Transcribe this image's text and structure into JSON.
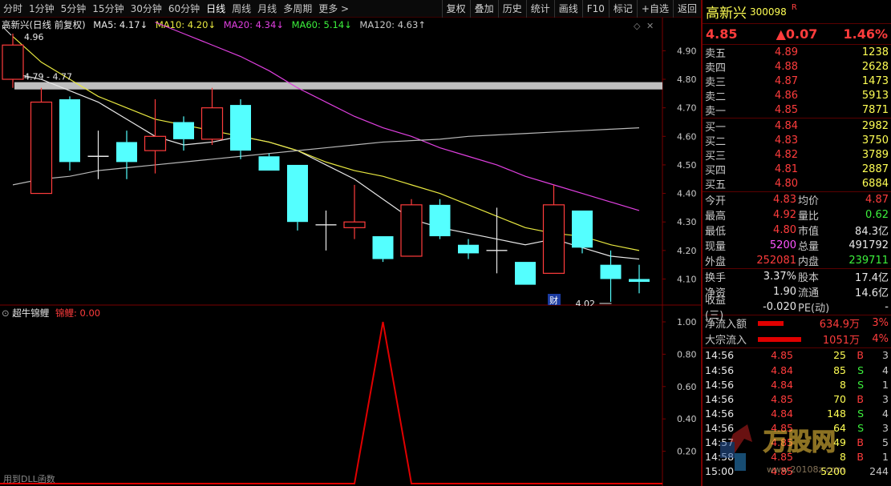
{
  "toolbar": {
    "periods": [
      "分时",
      "1分钟",
      "5分钟",
      "15分钟",
      "30分钟",
      "60分钟",
      "日线",
      "周线",
      "月线",
      "多周期",
      "更多 >"
    ],
    "active_period": "日线",
    "buttons": [
      "复权",
      "叠加",
      "历史",
      "统计",
      "画线",
      "F10",
      "标记",
      "+自选",
      "返回"
    ]
  },
  "main_legend": {
    "title": "高新兴(日线 前复权)",
    "ma5": "MA5: 4.17↓",
    "ma10": "MA10: 4.20↓",
    "ma20": "MA20: 4.34↓",
    "ma60": "MA60: 5.14↓",
    "ma120": "MA120: 4.63↑"
  },
  "sub_legend": {
    "name": "超牛锦鲤",
    "series": "锦鲤: 0.00"
  },
  "footnote": "用到DLL函数",
  "chart_data": [
    {
      "type": "candlestick",
      "title": "高新兴(日线 前复权)",
      "ylim": [
        4.02,
        4.96
      ],
      "yticks": [
        "4.90",
        "4.80",
        "4.70",
        "4.60",
        "4.50",
        "4.40",
        "4.30",
        "4.20",
        "4.10"
      ],
      "annotations": {
        "high": "4.96",
        "low": "4.02",
        "range_line": "4.79 - 4.77",
        "marker": "财"
      },
      "candles": [
        {
          "o": 4.8,
          "h": 4.96,
          "l": 4.77,
          "c": 4.92
        },
        {
          "o": 4.4,
          "h": 4.77,
          "l": 4.4,
          "c": 4.72
        },
        {
          "o": 4.73,
          "h": 4.74,
          "l": 4.48,
          "c": 4.51
        },
        {
          "o": 4.53,
          "h": 4.62,
          "l": 4.45,
          "c": 4.53
        },
        {
          "o": 4.58,
          "h": 4.62,
          "l": 4.45,
          "c": 4.51
        },
        {
          "o": 4.55,
          "h": 4.73,
          "l": 4.47,
          "c": 4.6
        },
        {
          "o": 4.65,
          "h": 4.67,
          "l": 4.55,
          "c": 4.59
        },
        {
          "o": 4.59,
          "h": 4.77,
          "l": 4.57,
          "c": 4.7
        },
        {
          "o": 4.71,
          "h": 4.73,
          "l": 4.52,
          "c": 4.55
        },
        {
          "o": 4.53,
          "h": 4.54,
          "l": 4.48,
          "c": 4.48
        },
        {
          "o": 4.5,
          "h": 4.5,
          "l": 4.27,
          "c": 4.3
        },
        {
          "o": 4.29,
          "h": 4.34,
          "l": 4.2,
          "c": 4.29
        },
        {
          "o": 4.28,
          "h": 4.43,
          "l": 4.24,
          "c": 4.3
        },
        {
          "o": 4.25,
          "h": 4.25,
          "l": 4.16,
          "c": 4.17
        },
        {
          "o": 4.18,
          "h": 4.38,
          "l": 4.18,
          "c": 4.36
        },
        {
          "o": 4.36,
          "h": 4.38,
          "l": 4.24,
          "c": 4.25
        },
        {
          "o": 4.22,
          "h": 4.24,
          "l": 4.17,
          "c": 4.19
        },
        {
          "o": 4.2,
          "h": 4.35,
          "l": 4.12,
          "c": 4.2
        },
        {
          "o": 4.16,
          "h": 4.16,
          "l": 4.08,
          "c": 4.08
        },
        {
          "o": 4.12,
          "h": 4.43,
          "l": 4.12,
          "c": 4.36
        },
        {
          "o": 4.34,
          "h": 4.34,
          "l": 4.19,
          "c": 4.21
        },
        {
          "o": 4.15,
          "h": 4.2,
          "l": 4.02,
          "c": 4.1
        },
        {
          "o": 4.1,
          "h": 4.15,
          "l": 4.05,
          "c": 4.09
        }
      ],
      "series": [
        {
          "name": "MA5",
          "color": "#e8e8e8",
          "values": [
            4.82,
            4.8,
            4.76,
            4.72,
            4.66,
            4.6,
            4.57,
            4.58,
            4.6,
            4.58,
            4.55,
            4.5,
            4.45,
            4.38,
            4.31,
            4.28,
            4.26,
            4.24,
            4.22,
            4.24,
            4.21,
            4.18,
            4.17
          ]
        },
        {
          "name": "MA10",
          "color": "#e8e840",
          "values": [
            4.95,
            4.86,
            4.8,
            4.74,
            4.7,
            4.66,
            4.64,
            4.62,
            4.6,
            4.58,
            4.55,
            4.51,
            4.48,
            4.46,
            4.43,
            4.4,
            4.36,
            4.32,
            4.28,
            4.26,
            4.25,
            4.22,
            4.2
          ]
        },
        {
          "name": "MA20",
          "color": "#e040e0",
          "values": [
            null,
            null,
            null,
            null,
            null,
            5.0,
            4.96,
            4.92,
            4.88,
            4.83,
            4.77,
            4.72,
            4.67,
            4.63,
            4.6,
            4.56,
            4.53,
            4.5,
            4.46,
            4.43,
            4.4,
            4.37,
            4.34
          ]
        },
        {
          "name": "MA120",
          "color": "#b8b8b8",
          "values": [
            4.43,
            4.45,
            4.46,
            4.48,
            4.49,
            4.5,
            4.51,
            4.52,
            4.53,
            4.54,
            4.55,
            4.56,
            4.57,
            4.58,
            4.585,
            4.59,
            4.6,
            4.605,
            4.61,
            4.615,
            4.62,
            4.625,
            4.63
          ]
        }
      ]
    },
    {
      "type": "line",
      "title": "超牛锦鲤",
      "ylim": [
        0,
        1
      ],
      "yticks": [
        "1.00",
        "0.80",
        "0.60",
        "0.40",
        "0.20"
      ],
      "series": [
        {
          "name": "锦鲤",
          "color": "#e00000",
          "values": [
            0,
            0,
            0,
            0,
            0,
            0,
            0,
            0,
            0,
            0,
            0,
            0,
            0,
            1,
            0,
            0,
            0,
            0,
            0,
            0,
            0,
            0,
            0
          ]
        }
      ]
    }
  ],
  "panel": {
    "name": "高新兴",
    "code": "300098",
    "r_badge": "R",
    "price": "4.85",
    "change": "▲0.07",
    "change_pct": "1.46%",
    "asks": [
      {
        "label": "卖五",
        "price": "4.89",
        "vol": "1238"
      },
      {
        "label": "卖四",
        "price": "4.88",
        "vol": "2628"
      },
      {
        "label": "卖三",
        "price": "4.87",
        "vol": "1473"
      },
      {
        "label": "卖二",
        "price": "4.86",
        "vol": "5913"
      },
      {
        "label": "卖一",
        "price": "4.85",
        "vol": "7871"
      }
    ],
    "bids": [
      {
        "label": "买一",
        "price": "4.84",
        "vol": "2982"
      },
      {
        "label": "买二",
        "price": "4.83",
        "vol": "3750"
      },
      {
        "label": "买三",
        "price": "4.82",
        "vol": "3789"
      },
      {
        "label": "买四",
        "price": "4.81",
        "vol": "2887"
      },
      {
        "label": "买五",
        "price": "4.80",
        "vol": "6884"
      }
    ],
    "quote": [
      {
        "l1": "今开",
        "v1": "4.83",
        "c1": "red",
        "l2": "均价",
        "v2": "4.87",
        "c2": "red"
      },
      {
        "l1": "最高",
        "v1": "4.92",
        "c1": "red",
        "l2": "量比",
        "v2": "0.62",
        "c2": "green"
      },
      {
        "l1": "最低",
        "v1": "4.80",
        "c1": "red",
        "l2": "市值",
        "v2": "84.3亿",
        "c2": "white"
      },
      {
        "l1": "现量",
        "v1": "5200",
        "c1": "magenta",
        "l2": "总量",
        "v2": "491792",
        "c2": "white"
      },
      {
        "l1": "外盘",
        "v1": "252081",
        "c1": "red",
        "l2": "内盘",
        "v2": "239711",
        "c2": "green"
      }
    ],
    "quote2": [
      {
        "l1": "换手",
        "v1": "3.37%",
        "c1": "white",
        "l2": "股本",
        "v2": "17.4亿",
        "c2": "white"
      },
      {
        "l1": "净资",
        "v1": "1.90",
        "c1": "white",
        "l2": "流通",
        "v2": "14.6亿",
        "c2": "white"
      },
      {
        "l1": "收益(三)",
        "v1": "-0.020",
        "c1": "white",
        "l2": "PE(动)",
        "v2": "-",
        "c2": "white"
      }
    ],
    "flows": [
      {
        "label": "净流入额",
        "value": "634.9万",
        "pct": "3%"
      },
      {
        "label": "大宗流入",
        "value": "1051万",
        "pct": "4%"
      }
    ],
    "ticks": [
      {
        "time": "14:56",
        "price": "4.85",
        "pc": "red",
        "vol": "25",
        "dir": "B",
        "dc": "red",
        "n": "3"
      },
      {
        "time": "14:56",
        "price": "4.84",
        "pc": "red",
        "vol": "85",
        "dir": "S",
        "dc": "green",
        "n": "4"
      },
      {
        "time": "14:56",
        "price": "4.84",
        "pc": "red",
        "vol": "8",
        "dir": "S",
        "dc": "green",
        "n": "1"
      },
      {
        "time": "14:56",
        "price": "4.85",
        "pc": "red",
        "vol": "70",
        "dir": "B",
        "dc": "red",
        "n": "3"
      },
      {
        "time": "14:56",
        "price": "4.84",
        "pc": "red",
        "vol": "148",
        "dir": "S",
        "dc": "green",
        "n": "4"
      },
      {
        "time": "14:56",
        "price": "4.85",
        "pc": "red",
        "vol": "64",
        "dir": "S",
        "dc": "green",
        "n": "3"
      },
      {
        "time": "14:57",
        "price": "4.85",
        "pc": "red",
        "vol": "49",
        "dir": "B",
        "dc": "red",
        "n": "5"
      },
      {
        "time": "14:58",
        "price": "4.85",
        "pc": "red",
        "vol": "8",
        "dir": "B",
        "dc": "red",
        "n": "1"
      },
      {
        "time": "15:00",
        "price": "4.85",
        "pc": "red",
        "vol": "5200",
        "dir": "",
        "dc": "red",
        "n": "244"
      }
    ]
  },
  "watermark": {
    "brand": "万股网",
    "url": "www.20108z.com"
  },
  "colors": {
    "up": "#ff3c3c",
    "down_fill": "#54ffff",
    "grid": "#7a0000",
    "axis_text": "#c8c8c8",
    "signal": "#e00000",
    "highlight_band": "#bfbfbf"
  }
}
